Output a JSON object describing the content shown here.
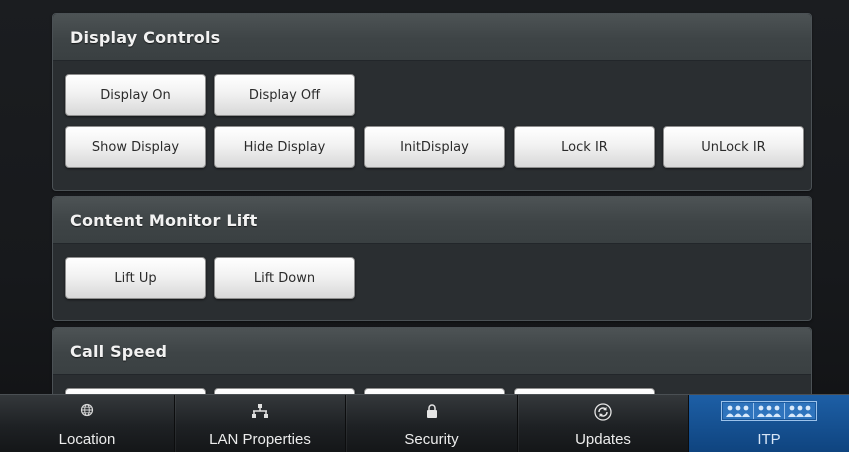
{
  "panels": [
    {
      "title": "Display Controls",
      "rows": [
        [
          "Display On",
          "Display Off"
        ],
        [
          "Show Display",
          "Hide Display",
          "InitDisplay",
          "Lock IR",
          "UnLock IR"
        ]
      ]
    },
    {
      "title": "Content Monitor Lift",
      "rows": [
        [
          "Lift Up",
          "Lift Down"
        ]
      ]
    },
    {
      "title": "Call Speed"
    }
  ],
  "navbar": {
    "items": [
      {
        "label": "Location",
        "icon": "globe-icon"
      },
      {
        "label": "LAN Properties",
        "icon": "network-icon"
      },
      {
        "label": "Security",
        "icon": "lock-icon"
      },
      {
        "label": "Updates",
        "icon": "refresh-icon"
      },
      {
        "label": "ITP",
        "icon": "itp-people-icon",
        "active": true
      }
    ]
  },
  "colors": {
    "panel_bg": "#2a2e31",
    "panel_header": "#3e4446",
    "button_bg": "#f2f2f2",
    "active_tab": "#1d5fa6"
  }
}
